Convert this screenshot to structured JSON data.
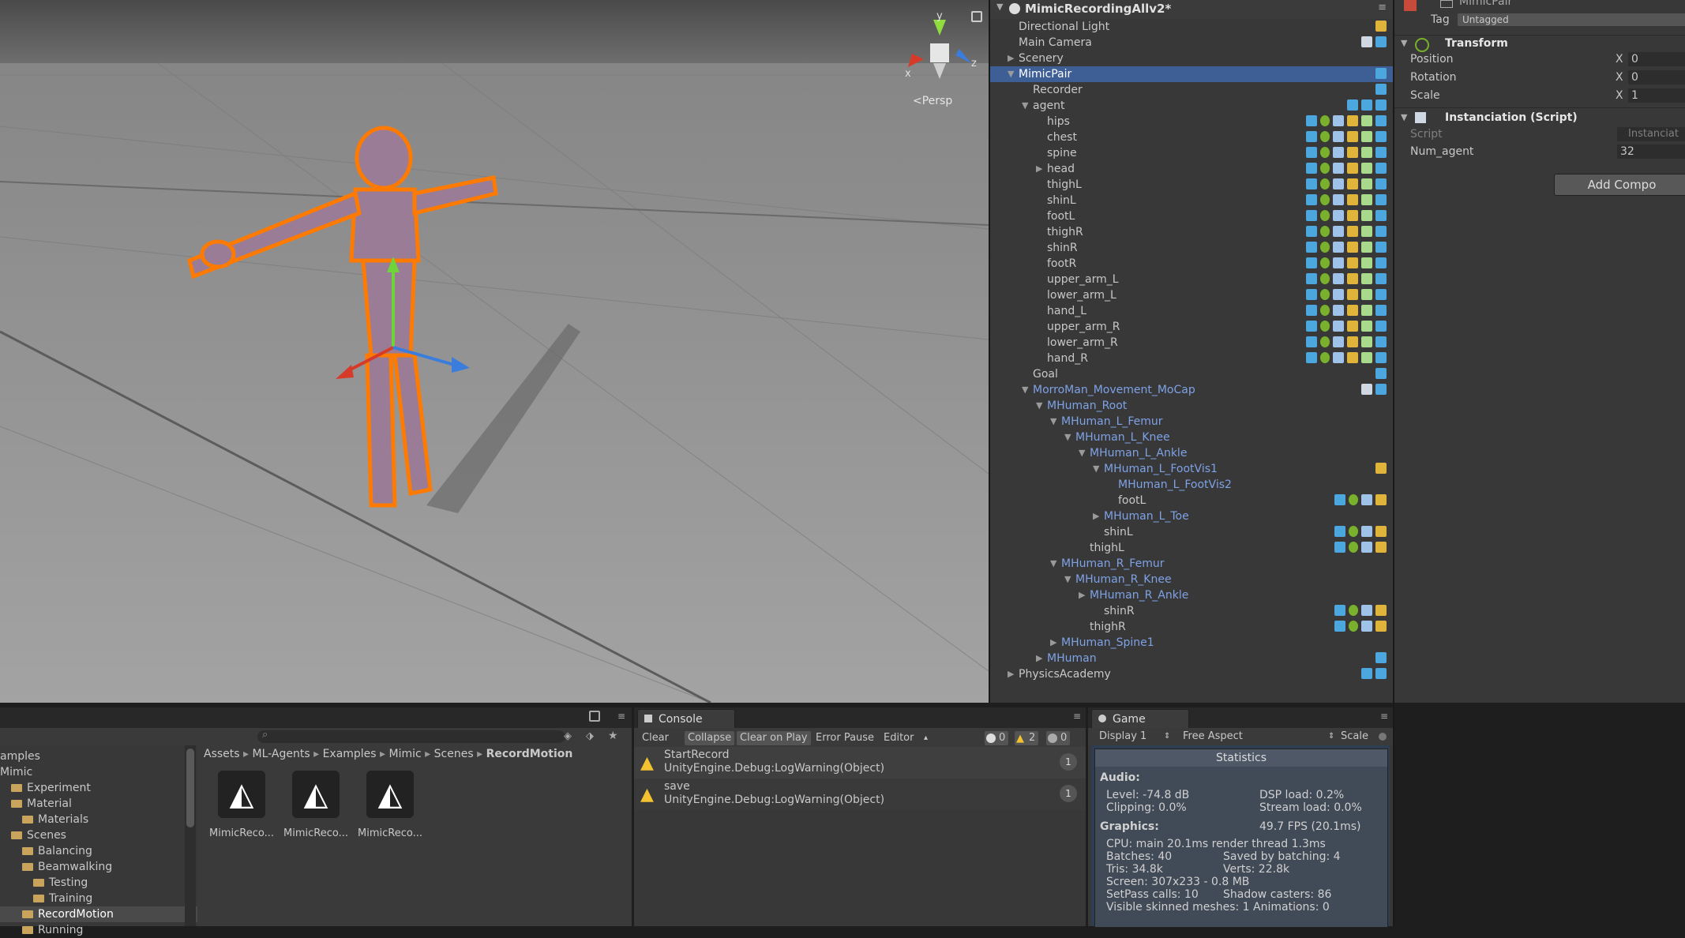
{
  "scene": {
    "persp_label": "<Persp",
    "gizmo_axes": {
      "y": "y",
      "z": "z",
      "x": "x"
    }
  },
  "hierarchy": {
    "scene_name": "MimicRecordingAllv2*",
    "rows": [
      {
        "label": "Directional Light",
        "depth": 0,
        "arrow": "",
        "color": "normal",
        "icons": [
          "y"
        ]
      },
      {
        "label": "Main Camera",
        "depth": 0,
        "arrow": "",
        "color": "normal",
        "icons": [
          "w",
          "b"
        ]
      },
      {
        "label": "Scenery",
        "depth": 0,
        "arrow": "right",
        "color": "normal",
        "icons": []
      },
      {
        "label": "MimicPair",
        "depth": 0,
        "arrow": "down",
        "color": "normal",
        "icons": [
          "b"
        ],
        "selected": true
      },
      {
        "label": "Recorder",
        "depth": 1,
        "arrow": "",
        "color": "normal",
        "icons": [
          "b"
        ]
      },
      {
        "label": "agent",
        "depth": 1,
        "arrow": "down",
        "color": "normal",
        "icons": [
          "b",
          "b",
          "b"
        ]
      },
      {
        "label": "hips",
        "depth": 2,
        "arrow": "",
        "color": "normal",
        "icons": [
          "b",
          "g",
          "p",
          "y",
          "c",
          "b"
        ]
      },
      {
        "label": "chest",
        "depth": 2,
        "arrow": "",
        "color": "normal",
        "icons": [
          "b",
          "g",
          "p",
          "y",
          "c",
          "b"
        ]
      },
      {
        "label": "spine",
        "depth": 2,
        "arrow": "",
        "color": "normal",
        "icons": [
          "b",
          "g",
          "p",
          "y",
          "c",
          "b"
        ]
      },
      {
        "label": "head",
        "depth": 2,
        "arrow": "right",
        "color": "normal",
        "icons": [
          "b",
          "g",
          "p",
          "y",
          "c",
          "b"
        ]
      },
      {
        "label": "thighL",
        "depth": 2,
        "arrow": "",
        "color": "normal",
        "icons": [
          "b",
          "g",
          "p",
          "y",
          "c",
          "b"
        ]
      },
      {
        "label": "shinL",
        "depth": 2,
        "arrow": "",
        "color": "normal",
        "icons": [
          "b",
          "g",
          "p",
          "y",
          "c",
          "b"
        ]
      },
      {
        "label": "footL",
        "depth": 2,
        "arrow": "",
        "color": "normal",
        "icons": [
          "b",
          "g",
          "p",
          "y",
          "c",
          "b"
        ]
      },
      {
        "label": "thighR",
        "depth": 2,
        "arrow": "",
        "color": "normal",
        "icons": [
          "b",
          "g",
          "p",
          "y",
          "c",
          "b"
        ]
      },
      {
        "label": "shinR",
        "depth": 2,
        "arrow": "",
        "color": "normal",
        "icons": [
          "b",
          "g",
          "p",
          "y",
          "c",
          "b"
        ]
      },
      {
        "label": "footR",
        "depth": 2,
        "arrow": "",
        "color": "normal",
        "icons": [
          "b",
          "g",
          "p",
          "y",
          "c",
          "b"
        ]
      },
      {
        "label": "upper_arm_L",
        "depth": 2,
        "arrow": "",
        "color": "normal",
        "icons": [
          "b",
          "g",
          "p",
          "y",
          "c",
          "b"
        ]
      },
      {
        "label": "lower_arm_L",
        "depth": 2,
        "arrow": "",
        "color": "normal",
        "icons": [
          "b",
          "g",
          "p",
          "y",
          "c",
          "b"
        ]
      },
      {
        "label": "hand_L",
        "depth": 2,
        "arrow": "",
        "color": "normal",
        "icons": [
          "b",
          "g",
          "p",
          "y",
          "c",
          "b"
        ]
      },
      {
        "label": "upper_arm_R",
        "depth": 2,
        "arrow": "",
        "color": "normal",
        "icons": [
          "b",
          "g",
          "p",
          "y",
          "c",
          "b"
        ]
      },
      {
        "label": "lower_arm_R",
        "depth": 2,
        "arrow": "",
        "color": "normal",
        "icons": [
          "b",
          "g",
          "p",
          "y",
          "c",
          "b"
        ]
      },
      {
        "label": "hand_R",
        "depth": 2,
        "arrow": "",
        "color": "normal",
        "icons": [
          "b",
          "g",
          "p",
          "y",
          "c",
          "b"
        ]
      },
      {
        "label": "Goal",
        "depth": 1,
        "arrow": "",
        "color": "normal",
        "icons": [
          "b"
        ]
      },
      {
        "label": "MorroMan_Movement_MoCap",
        "depth": 1,
        "arrow": "down",
        "color": "blue",
        "icons": [
          "w",
          "b"
        ]
      },
      {
        "label": "MHuman_Root",
        "depth": 2,
        "arrow": "down",
        "color": "blue",
        "icons": []
      },
      {
        "label": "MHuman_L_Femur",
        "depth": 3,
        "arrow": "down",
        "color": "blue",
        "icons": []
      },
      {
        "label": "MHuman_L_Knee",
        "depth": 4,
        "arrow": "down",
        "color": "blue",
        "icons": []
      },
      {
        "label": "MHuman_L_Ankle",
        "depth": 5,
        "arrow": "down",
        "color": "blue",
        "icons": []
      },
      {
        "label": "MHuman_L_FootVis1",
        "depth": 6,
        "arrow": "down",
        "color": "blue",
        "icons": [
          "y"
        ]
      },
      {
        "label": "MHuman_L_FootVis2",
        "depth": 7,
        "arrow": "",
        "color": "blue",
        "icons": []
      },
      {
        "label": "footL",
        "depth": 7,
        "arrow": "",
        "color": "normal",
        "icons": [
          "b",
          "g",
          "p",
          "y"
        ]
      },
      {
        "label": "MHuman_L_Toe",
        "depth": 6,
        "arrow": "right",
        "color": "blue",
        "icons": []
      },
      {
        "label": "shinL",
        "depth": 6,
        "arrow": "",
        "color": "normal",
        "icons": [
          "b",
          "g",
          "p",
          "y"
        ]
      },
      {
        "label": "thighL",
        "depth": 5,
        "arrow": "",
        "color": "normal",
        "icons": [
          "b",
          "g",
          "p",
          "y"
        ]
      },
      {
        "label": "MHuman_R_Femur",
        "depth": 3,
        "arrow": "down",
        "color": "blue",
        "icons": []
      },
      {
        "label": "MHuman_R_Knee",
        "depth": 4,
        "arrow": "down",
        "color": "blue",
        "icons": []
      },
      {
        "label": "MHuman_R_Ankle",
        "depth": 5,
        "arrow": "right",
        "color": "blue",
        "icons": []
      },
      {
        "label": "shinR",
        "depth": 6,
        "arrow": "",
        "color": "normal",
        "icons": [
          "b",
          "g",
          "p",
          "y"
        ]
      },
      {
        "label": "thighR",
        "depth": 5,
        "arrow": "",
        "color": "normal",
        "icons": [
          "b",
          "g",
          "p",
          "y"
        ]
      },
      {
        "label": "MHuman_Spine1",
        "depth": 3,
        "arrow": "right",
        "color": "blue",
        "icons": []
      },
      {
        "label": "MHuman",
        "depth": 2,
        "arrow": "right",
        "color": "blue",
        "icons": [
          "b"
        ]
      },
      {
        "label": "PhysicsAcademy",
        "depth": 0,
        "arrow": "right",
        "color": "normal",
        "icons": [
          "b",
          "b"
        ]
      }
    ]
  },
  "inspector": {
    "object_name": "MimicPair",
    "tag_label": "Tag",
    "tag_value": "Untagged",
    "transform_title": "Transform",
    "position_label": "Position",
    "rotation_label": "Rotation",
    "scale_label": "Scale",
    "x_label": "X",
    "position_x": "0",
    "rotation_x": "0",
    "scale_x": "1",
    "script_component_title": "Instanciation (Script)",
    "script_label": "Script",
    "script_value": "Instanciat",
    "num_agent_label": "Num_agent",
    "num_agent_value": "32",
    "add_component": "Add Compo"
  },
  "project": {
    "search_placeholder": "",
    "tree": [
      {
        "label": "amples",
        "indent": 0,
        "folder": false
      },
      {
        "label": "Mimic",
        "indent": 0,
        "folder": false
      },
      {
        "label": "Experiment",
        "indent": 1,
        "folder": true
      },
      {
        "label": "Material",
        "indent": 1,
        "folder": true
      },
      {
        "label": "Materials",
        "indent": 2,
        "folder": true
      },
      {
        "label": "Scenes",
        "indent": 1,
        "folder": true
      },
      {
        "label": "Balancing",
        "indent": 2,
        "folder": true
      },
      {
        "label": "Beamwalking",
        "indent": 2,
        "folder": true
      },
      {
        "label": "Testing",
        "indent": 3,
        "folder": true
      },
      {
        "label": "Training",
        "indent": 3,
        "folder": true
      },
      {
        "label": "RecordMotion",
        "indent": 2,
        "folder": true,
        "selected": true
      },
      {
        "label": "Running",
        "indent": 2,
        "folder": true
      }
    ],
    "breadcrumb": [
      "Assets",
      "ML-Agents",
      "Examples",
      "Mimic",
      "Scenes",
      "RecordMotion"
    ],
    "assets": [
      "MimicReco...",
      "MimicReco...",
      "MimicReco..."
    ]
  },
  "console": {
    "tab": "Console",
    "buttons": {
      "clear": "Clear",
      "collapse": "Collapse",
      "clear_on_play": "Clear on Play",
      "error_pause": "Error Pause",
      "editor": "Editor"
    },
    "counts": {
      "info": "0",
      "warn": "2",
      "error": "0"
    },
    "entries": [
      {
        "line1": "StartRecord",
        "line2": "UnityEngine.Debug:LogWarning(Object)",
        "count": "1"
      },
      {
        "line1": "save",
        "line2": "UnityEngine.Debug:LogWarning(Object)",
        "count": "1"
      }
    ]
  },
  "game": {
    "tab": "Game",
    "display": "Display 1",
    "aspect": "Free Aspect",
    "scale": "Scale",
    "stats": {
      "title": "Statistics",
      "audio": "Audio:",
      "level": "Level: -74.8 dB",
      "dsp": "DSP load: 0.2%",
      "clipping": "Clipping: 0.0%",
      "stream": "Stream load: 0.0%",
      "graphics": "Graphics:",
      "fps": "49.7 FPS (20.1ms)",
      "cpu": "CPU: main 20.1ms  render thread 1.3ms",
      "batches": "Batches: 40",
      "saved": "Saved by batching: 4",
      "tris": "Tris: 34.8k",
      "verts": "Verts: 22.8k",
      "screen": "Screen: 307x233 - 0.8 MB",
      "setpass": "SetPass calls: 10",
      "shadow": "Shadow casters: 86",
      "skinned": "Visible skinned meshes: 1  Animations: 0"
    }
  }
}
